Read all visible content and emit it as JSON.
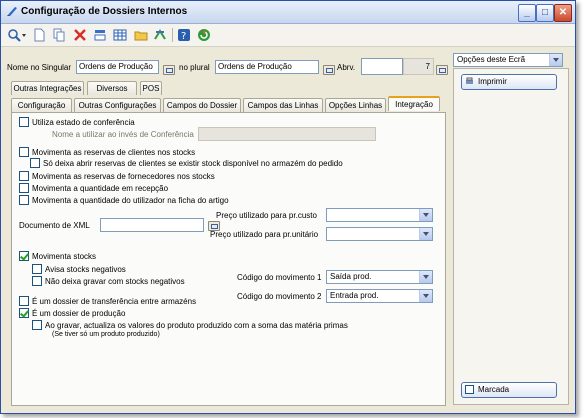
{
  "window": {
    "title": "Configuração de Dossiers Internos"
  },
  "header": {
    "singular_label": "Nome no Singular",
    "singular_value": "Ordens de Produção",
    "plural_label": "no plural",
    "plural_value": "Ordens de Produção",
    "abrev_label": "Abrv.",
    "abrev_value": "",
    "number_value": "7"
  },
  "tabs_row1": [
    "Outras Integrações",
    "Diversos",
    "POS"
  ],
  "tabs_row2": [
    "Configuração",
    "Outras Configurações",
    "Campos do Dossier",
    "Campos das Linhas",
    "Opções Linhas",
    "Integração"
  ],
  "integration": {
    "estado_conf": "Utiliza estado de conferência",
    "nome_conf_label": "Nome a utilizar ao invés de Conferência",
    "mov_reservas_clientes": "Movimenta as reservas de clientes nos stocks",
    "so_abrir_reservas": "Só deixa abrir reservas de clientes se existir stock disponível no armazém do pedido",
    "mov_reservas_fornecedores": "Movimenta as reservas de fornecedores nos stocks",
    "mov_qtd_recepcao": "Movimenta a quantidade em recepção",
    "mov_qtd_utilizador": "Movimenta a quantidade do utilizador na ficha do artigo",
    "doc_xml_label": "Documento de XML",
    "doc_xml_value": "",
    "preco_custo_label": "Preço utilizado para pr.custo",
    "preco_custo_value": "",
    "preco_unit_label": "Preço utilizado para pr.unitário",
    "preco_unit_value": "",
    "mov_stocks": "Movimenta stocks",
    "avisa_neg": "Avisa stocks negativos",
    "nao_gravar_neg": "Não deixa gravar com stocks negativos",
    "cod_mov1_label": "Código do movimento 1",
    "cod_mov1_value": "Saída prod.",
    "cod_mov2_label": "Código do movimento 2",
    "cod_mov2_value": "Entrada prod.",
    "transferencia": "É um dossier de transferência entre armazéns",
    "producao": "É um dossier de produção",
    "actualiza": "Ao gravar, actualiza os valores do produto produzido com a soma das matéria primas",
    "actualiza_note": "(Se tiver só um produto produzido)"
  },
  "side": {
    "options_label": "Opções deste Ecrã",
    "print_label": "Imprimir",
    "marked_label": "Marcada"
  },
  "colors": {
    "active_tab_accent": "#e5a21a",
    "check_green": "#21a121"
  }
}
